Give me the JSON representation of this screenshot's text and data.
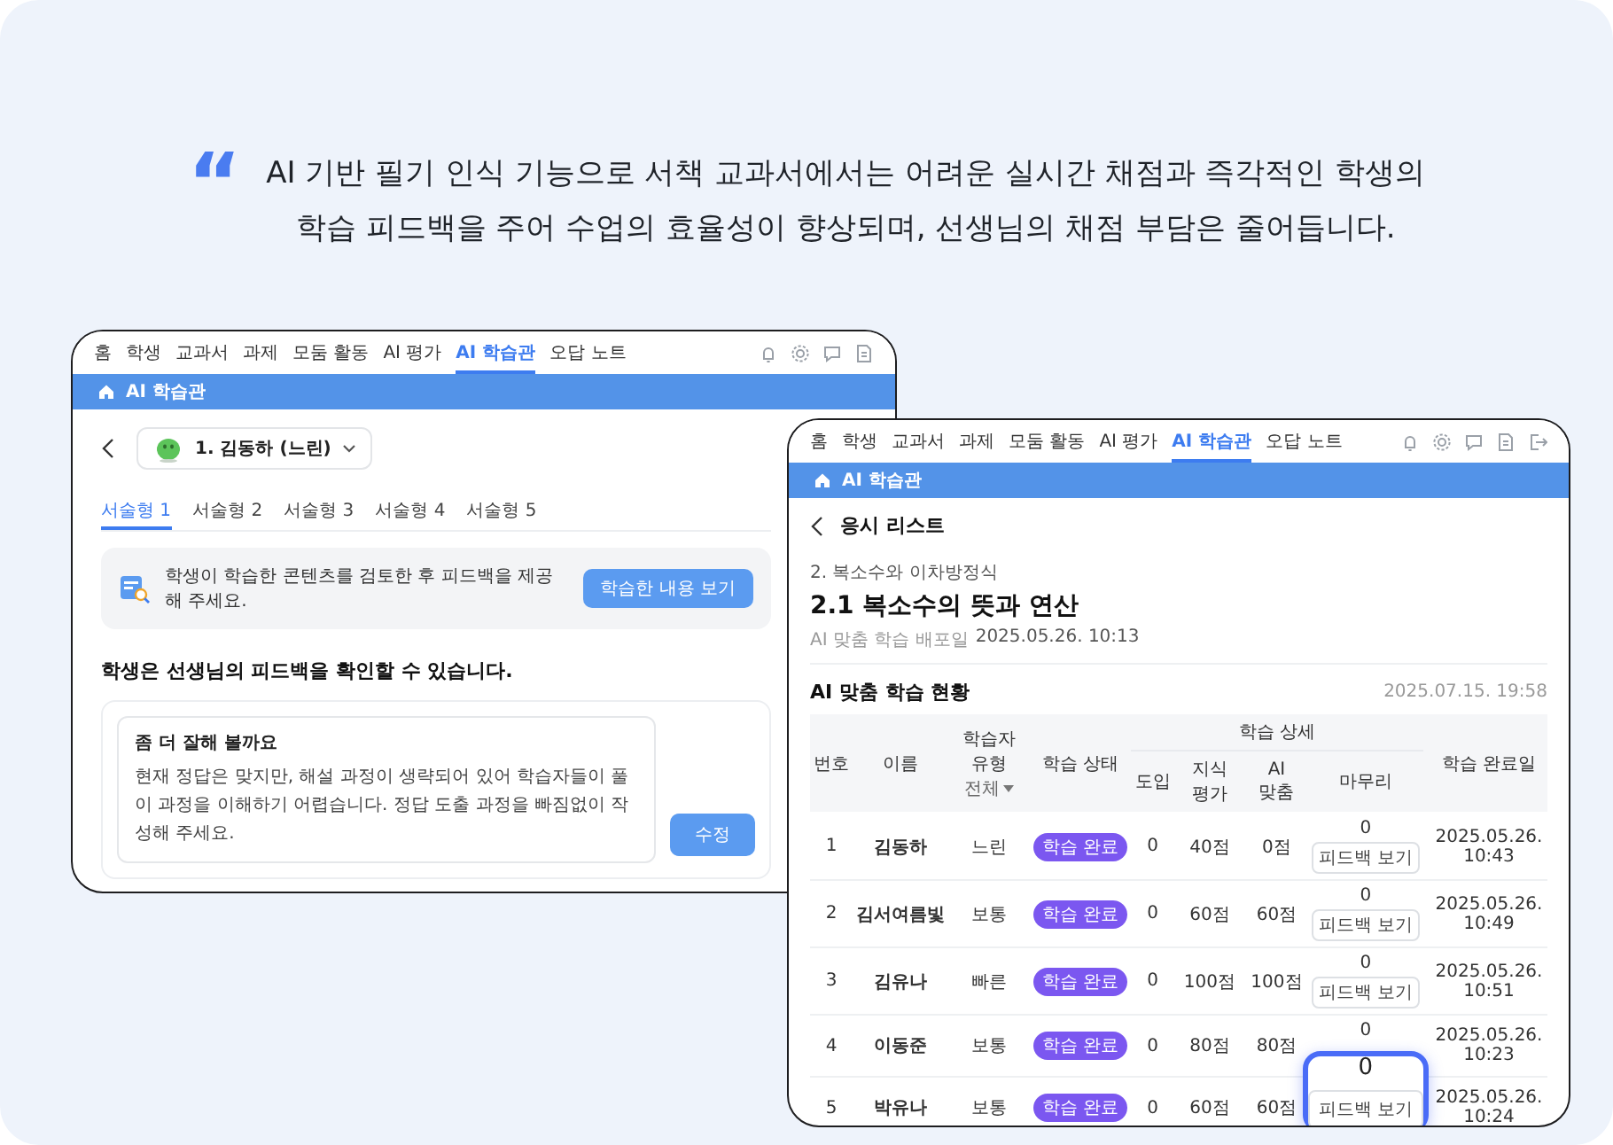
{
  "quote": {
    "mark": "“",
    "lines": [
      "AI 기반 필기 인식 기능으로 서책 교과서에서는 어려운 실시간 채점과 즉각적인 학생의",
      "학습 피드백을 주어 수업의 효율성이 향상되며, 선생님의 채점 부담은 줄어듭니다."
    ]
  },
  "left_window": {
    "nav": [
      {
        "label": "홈",
        "selected": false
      },
      {
        "label": "학생",
        "selected": false
      },
      {
        "label": "교과서",
        "selected": false
      },
      {
        "label": "과제",
        "selected": false
      },
      {
        "label": "모둠 활동",
        "selected": false
      },
      {
        "label": "AI 평가",
        "selected": false
      },
      {
        "label": "AI 학습관",
        "selected": true
      },
      {
        "label": "오답 노트",
        "selected": false
      }
    ],
    "bar_title": "AI 학습관",
    "student": "1. 김동하 (느린)",
    "tabs": [
      {
        "label": "서술형 1",
        "selected": true
      },
      {
        "label": "서술형 2",
        "selected": false
      },
      {
        "label": "서술형 3",
        "selected": false
      },
      {
        "label": "서술형 4",
        "selected": false
      },
      {
        "label": "서술형 5",
        "selected": false
      }
    ],
    "notice": {
      "text": "학생이 학습한 콘텐츠를 검토한 후 피드백을 제공해 주세요.",
      "button": "학습한 내용 보기"
    },
    "heading": "학생은 선생님의 피드백을 확인할 수 있습니다.",
    "feedback": {
      "title": "좀 더 잘해 볼까요",
      "body": "현재 정답은 맞지만, 해설 과정이 생략되어 있어 학습자들이 풀이 과정을 이해하기 어렵습니다. 정답 도출 과정을 빠짐없이 작성해 주세요.",
      "button": "수정"
    }
  },
  "right_window": {
    "nav": [
      {
        "label": "홈",
        "selected": false
      },
      {
        "label": "학생",
        "selected": false
      },
      {
        "label": "교과서",
        "selected": false
      },
      {
        "label": "과제",
        "selected": false
      },
      {
        "label": "모둠 활동",
        "selected": false
      },
      {
        "label": "AI 평가",
        "selected": false
      },
      {
        "label": "AI 학습관",
        "selected": true
      },
      {
        "label": "오답 노트",
        "selected": false
      }
    ],
    "bar_title": "AI 학습관",
    "back_title": "응시 리스트",
    "chapter": "2. 복소수와 이차방정식",
    "title": "2.1 복소수의 뜻과 연산",
    "distributed": {
      "label": "AI 맞춤 학습 배포일",
      "value": "2025.05.26. 10:13"
    },
    "section_title": "AI 맞춤 학습 현황",
    "updated": "2025.07.15. 19:58",
    "table": {
      "columns": [
        "번호",
        "이름",
        "학습자 유형",
        "학습 상태"
      ],
      "type_filter": "전체",
      "group": "학습 상세",
      "group_columns": [
        "도입",
        "지식 평가",
        "AI 맞춤",
        "마무리"
      ],
      "last_column": "학습 완료일",
      "rows": [
        {
          "number": "1",
          "name": "김동하",
          "type": "느린",
          "status": "학습 완료",
          "intro": "0",
          "knowledge": "40점",
          "ai": "0점",
          "closing": {
            "kind": "normal",
            "score": "0",
            "button": "피드백 보기"
          },
          "completed": "2025.05.26. 10:43"
        },
        {
          "number": "2",
          "name": "김서여름빛",
          "type": "보통",
          "status": "학습 완료",
          "intro": "0",
          "knowledge": "60점",
          "ai": "60점",
          "closing": {
            "kind": "normal",
            "score": "0",
            "button": "피드백 보기"
          },
          "completed": "2025.05.26. 10:49"
        },
        {
          "number": "3",
          "name": "김유나",
          "type": "빠른",
          "status": "학습 완료",
          "intro": "0",
          "knowledge": "100점",
          "ai": "100점",
          "closing": {
            "kind": "normal",
            "score": "0",
            "button": "피드백 보기"
          },
          "completed": "2025.05.26. 10:51"
        },
        {
          "number": "4",
          "name": "이동준",
          "type": "보통",
          "status": "학습 완료",
          "intro": "0",
          "knowledge": "80점",
          "ai": "80점",
          "closing": {
            "kind": "covered",
            "score": "0"
          },
          "completed": "2025.05.26. 10:23"
        },
        {
          "number": "5",
          "name": "박유나",
          "type": "보통",
          "status": "학습 완료",
          "intro": "0",
          "knowledge": "60점",
          "ai": "60점",
          "closing": {
            "kind": "highlight",
            "score": "0",
            "button": "피드백 보기"
          },
          "completed": "2025.05.26. 10:24"
        }
      ]
    }
  }
}
